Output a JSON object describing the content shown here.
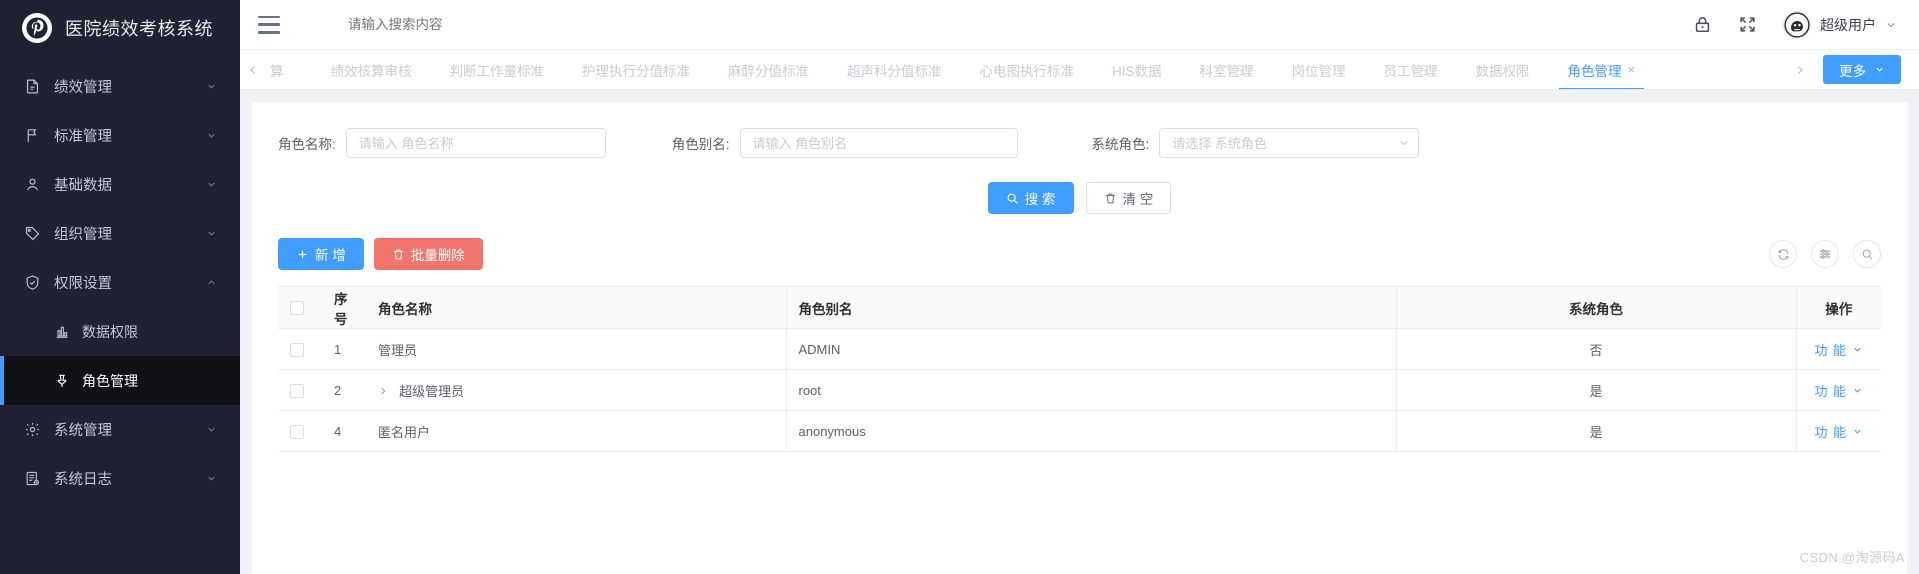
{
  "brand": {
    "logo_icon": "pinterest-logo-icon",
    "title": "医院绩效考核系统"
  },
  "topbar": {
    "menu_toggle_icon": "hamburger-icon",
    "search_placeholder": "请输入搜索内容",
    "search_value": "",
    "lock_icon": "lock-icon",
    "fullscreen_icon": "fullscreen-icon",
    "avatar_icon": "user-avatar",
    "user_name": "超级用户",
    "user_arrow_icon": "chevron-down-icon"
  },
  "sidebar": {
    "items": [
      {
        "label": "绩效管理",
        "icon": "document-icon",
        "arrow": "chevron-down-icon",
        "active": false,
        "sub": false
      },
      {
        "label": "标准管理",
        "icon": "flag-icon",
        "arrow": "chevron-down-icon",
        "active": false,
        "sub": false
      },
      {
        "label": "基础数据",
        "icon": "person-icon",
        "arrow": "chevron-down-icon",
        "active": false,
        "sub": false
      },
      {
        "label": "组织管理",
        "icon": "tag-icon",
        "arrow": "chevron-down-icon",
        "active": false,
        "sub": false
      },
      {
        "label": "权限设置",
        "icon": "shield-check-icon",
        "arrow": "chevron-up-icon",
        "active": false,
        "sub": false
      },
      {
        "label": "数据权限",
        "icon": "bar-chart-icon",
        "arrow": "",
        "active": false,
        "sub": true
      },
      {
        "label": "角色管理",
        "icon": "pin-icon",
        "arrow": "",
        "active": true,
        "sub": true
      },
      {
        "label": "系统管理",
        "icon": "gear-icon",
        "arrow": "chevron-down-icon",
        "active": false,
        "sub": false
      },
      {
        "label": "系统日志",
        "icon": "log-file-icon",
        "arrow": "chevron-down-icon",
        "active": false,
        "sub": false
      }
    ]
  },
  "tabs": {
    "scroll_left_icon": "chevron-left-icon",
    "scroll_right_icon": "chevron-right-icon",
    "items": [
      {
        "label": "算",
        "active": false,
        "closable": false
      },
      {
        "label": "绩效核算审核",
        "active": false,
        "closable": false
      },
      {
        "label": "判断工作量标准",
        "active": false,
        "closable": false
      },
      {
        "label": "护理执行分值标准",
        "active": false,
        "closable": false
      },
      {
        "label": "麻醉分值标准",
        "active": false,
        "closable": false
      },
      {
        "label": "超声科分值标准",
        "active": false,
        "closable": false
      },
      {
        "label": "心电图执行标准",
        "active": false,
        "closable": false
      },
      {
        "label": "HIS数据",
        "active": false,
        "closable": false
      },
      {
        "label": "科室管理",
        "active": false,
        "closable": false
      },
      {
        "label": "岗位管理",
        "active": false,
        "closable": false
      },
      {
        "label": "员工管理",
        "active": false,
        "closable": false
      },
      {
        "label": "数据权限",
        "active": false,
        "closable": false
      },
      {
        "label": "角色管理",
        "active": true,
        "closable": true
      }
    ],
    "close_glyph": "×",
    "more_label": "更多",
    "more_arrow_icon": "chevron-down-icon"
  },
  "search_form": {
    "fields": [
      {
        "label": "角色名称:",
        "placeholder": "请输入 角色名称",
        "value": "",
        "type": "text"
      },
      {
        "label": "角色别名:",
        "placeholder": "请输入 角色别名",
        "value": "",
        "type": "text"
      },
      {
        "label": "系统角色:",
        "placeholder": "请选择 系统角色",
        "value": "",
        "type": "select"
      }
    ],
    "search_button": {
      "label": "搜 索",
      "icon": "search-icon"
    },
    "clear_button": {
      "label": "清 空",
      "icon": "trash-icon"
    }
  },
  "toolbar": {
    "add_button": {
      "label": "新 增",
      "icon": "plus-icon"
    },
    "batch_delete_button": {
      "label": "批量删除",
      "icon": "trash-icon"
    },
    "refresh_icon": "refresh-icon",
    "column_settings_icon": "filter-settings-icon",
    "search_icon": "search-icon"
  },
  "table": {
    "headers": [
      "",
      "序号",
      "角色名称",
      "角色别名",
      "系统角色",
      "操作"
    ],
    "rows": [
      {
        "index": "1",
        "name": "管理员",
        "alias": "ADMIN",
        "system_role": "否",
        "action": "功 能",
        "expandable": false
      },
      {
        "index": "2",
        "name": "超级管理员",
        "alias": "root",
        "system_role": "是",
        "action": "功 能",
        "expandable": true
      },
      {
        "index": "4",
        "name": "匿名用户",
        "alias": "anonymous",
        "system_role": "是",
        "action": "功 能",
        "expandable": false
      }
    ],
    "action_arrow_icon": "chevron-down-icon",
    "expander_icon": "chevron-right-icon"
  },
  "watermark": {
    "text": "CSDN @淘源码A"
  },
  "colors": {
    "accent": "#409eff",
    "danger": "#f2756d",
    "sidebar_bg": "#1f2230",
    "sidebar_active_bg": "#0f1117"
  }
}
